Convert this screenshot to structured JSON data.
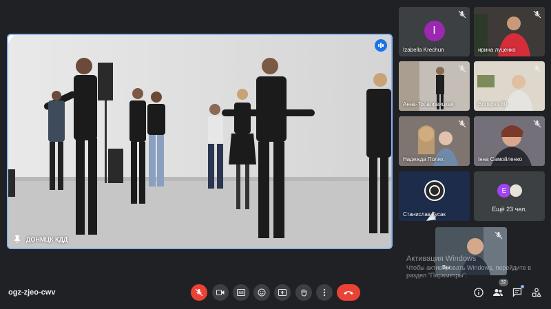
{
  "meeting": {
    "code": "ogz-zjeo-cwv"
  },
  "spotlight": {
    "name": "ДОНМЦК КДД"
  },
  "participants": [
    {
      "name": "Izabella Krechun",
      "avatar_letter": "I",
      "avatar_color": "#9c27b0",
      "muted": true
    },
    {
      "name": "ирина луценко",
      "muted": true
    },
    {
      "name": "Анна-Топаловицкая",
      "muted": true
    },
    {
      "name": "Borisova 80",
      "muted": true
    },
    {
      "name": "Надежда Полях",
      "muted": true
    },
    {
      "name": "Інна Самойленко",
      "muted": true
    },
    {
      "name": "Станислав Гусак",
      "muted": false
    }
  ],
  "more": {
    "avatar_letter": "E",
    "label": "Ещё 23 чел."
  },
  "self": {
    "name": "Вы",
    "muted": true
  },
  "activation": {
    "title": "Активация Windows",
    "line1": "Чтобы активировать Windows, перейдите в",
    "line2": "раздел \"Параметры\"."
  },
  "toolbar": {
    "buttons": [
      "mic-off-icon",
      "camera-icon",
      "captions-icon",
      "emoji-icon",
      "present-icon",
      "raise-hand-icon",
      "more-icon",
      "end-call-icon"
    ]
  },
  "side": {
    "participant_count": "32"
  },
  "colors": {
    "background": "#202124",
    "tile": "#3c4043",
    "accent": "#8ab4f8",
    "danger": "#ea4335"
  }
}
